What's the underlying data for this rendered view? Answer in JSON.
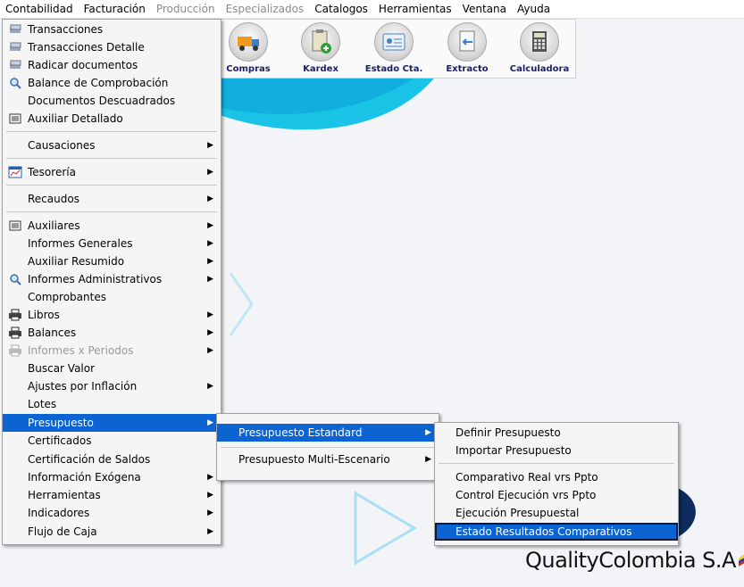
{
  "menubar": [
    {
      "label": "Contabilidad",
      "state": "active"
    },
    {
      "label": "Facturación",
      "state": "normal"
    },
    {
      "label": "Producción",
      "state": "disabled"
    },
    {
      "label": "Especializados",
      "state": "disabled"
    },
    {
      "label": "Catalogos",
      "state": "normal"
    },
    {
      "label": "Herramientas",
      "state": "normal"
    },
    {
      "label": "Ventana",
      "state": "normal"
    },
    {
      "label": "Ayuda",
      "state": "normal"
    }
  ],
  "toolbar": [
    {
      "label": "Compras",
      "icon": "truck-icon"
    },
    {
      "label": "Kardex",
      "icon": "clipboard-add-icon"
    },
    {
      "label": "Estado Cta.",
      "icon": "id-card-icon"
    },
    {
      "label": "Extracto",
      "icon": "document-arrow-icon"
    },
    {
      "label": "Calculadora",
      "icon": "calculator-icon"
    }
  ],
  "contabilidad_menu": [
    "Transacciones",
    "Transacciones Detalle",
    "Radicar documentos",
    "Balance de Comprobación",
    "Documentos Descuadrados",
    "Auxiliar Detallado",
    "Causaciones",
    "Tesorería",
    "Recaudos",
    "Auxiliares",
    "Informes Generales",
    "Auxiliar Resumido",
    "Informes Administrativos",
    "Comprobantes",
    "Libros",
    "Balances",
    "Informes x Periodos",
    "Buscar Valor",
    "Ajustes por Inflación",
    "Lotes",
    "Presupuesto",
    "Certificados",
    "Certificación de Saldos",
    "Información Exógena",
    "Herramientas",
    "Indicadores",
    "Flujo de Caja"
  ],
  "presupuesto_menu": [
    "Presupuesto  Estandard",
    "Presupuesto Multi-Escenario"
  ],
  "estandard_menu": [
    "Definir Presupuesto",
    "Importar Presupuesto",
    "Comparativo  Real vrs Ppto",
    "Control Ejecución vrs Ppto",
    "Ejecución Presupuestal",
    "Estado Resultados Comparativos"
  ],
  "logo": {
    "text": "QualityColombia S.A"
  },
  "colors": {
    "highlight": "#0c64d3",
    "accent": "#1ec8e8"
  }
}
